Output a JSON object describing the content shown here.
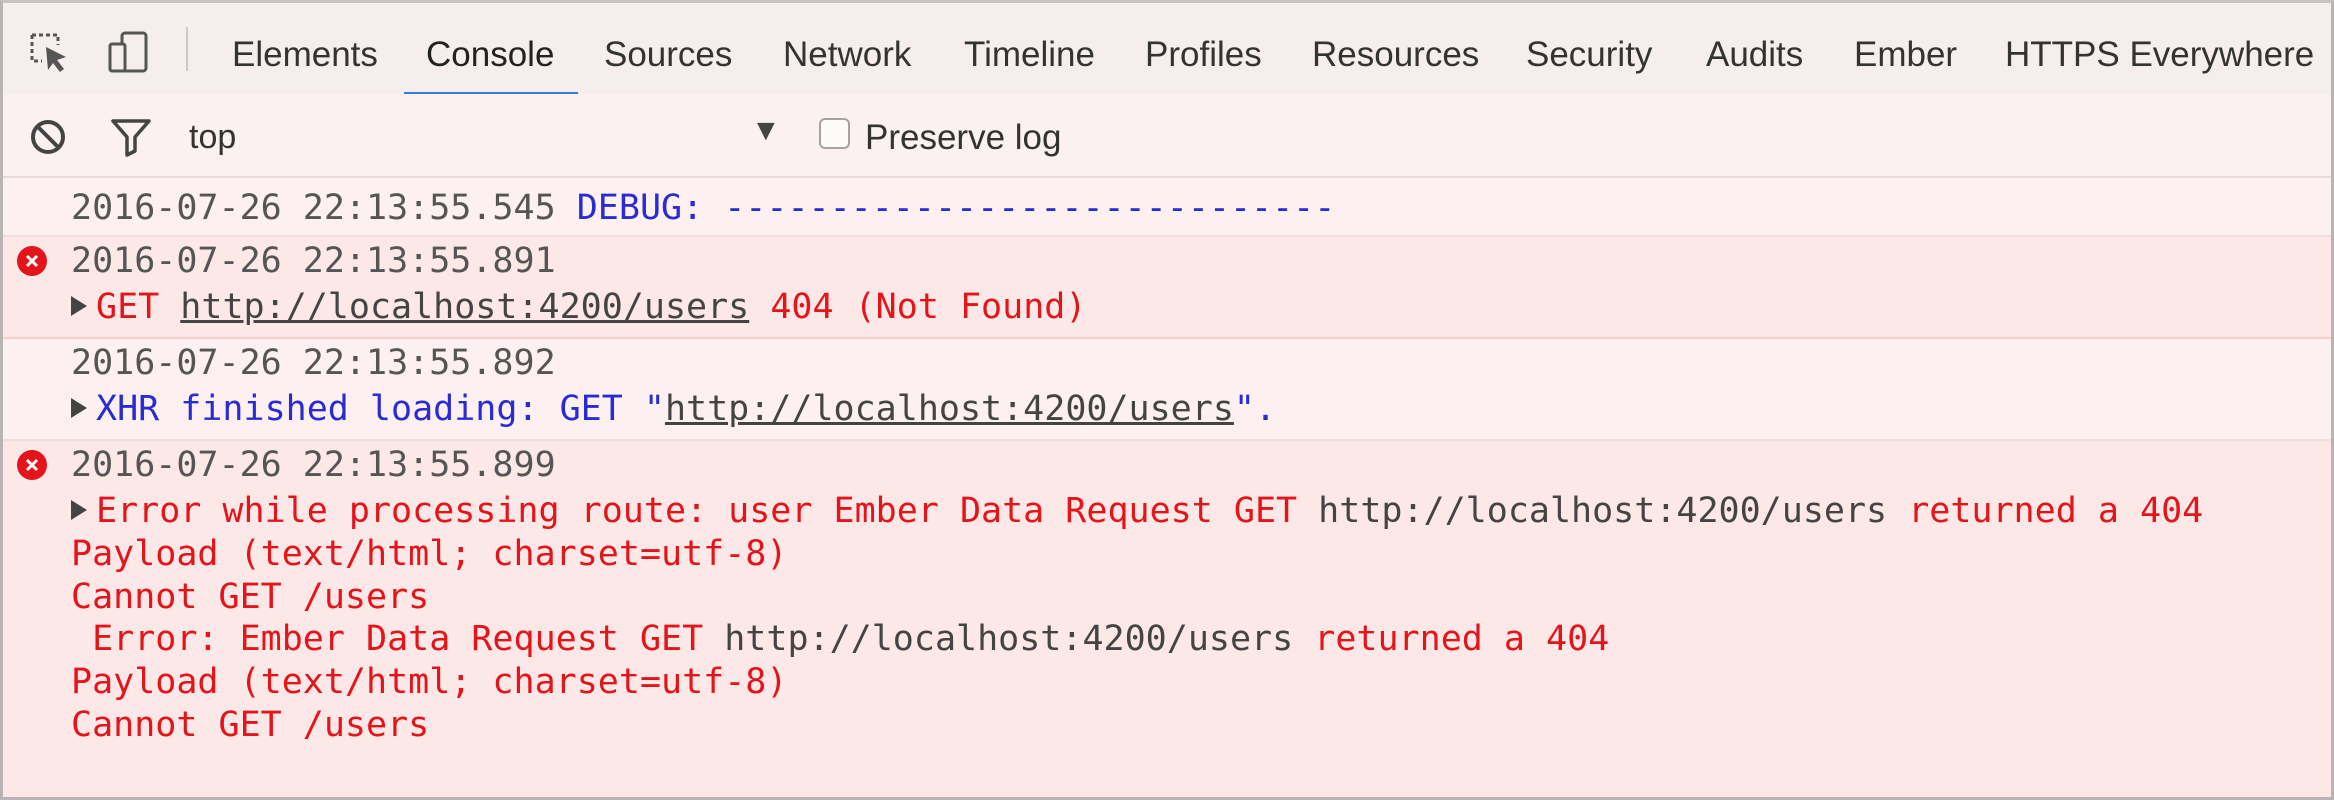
{
  "tabs": [
    {
      "label": "Elements"
    },
    {
      "label": "Console"
    },
    {
      "label": "Sources"
    },
    {
      "label": "Network"
    },
    {
      "label": "Timeline"
    },
    {
      "label": "Profiles"
    },
    {
      "label": "Resources"
    },
    {
      "label": "Security"
    },
    {
      "label": "Audits"
    },
    {
      "label": "Ember"
    },
    {
      "label": "HTTPS Everywhere"
    }
  ],
  "active_tab": "Console",
  "filter_bar": {
    "context": "top",
    "preserve_log_label": "Preserve log",
    "preserve_log_checked": false
  },
  "messages": {
    "m1": {
      "timestamp": "2016-07-26 22:13:55.545",
      "text": "DEBUG: -----------------------------"
    },
    "m2": {
      "level": "error",
      "timestamp": "2016-07-26 22:13:55.891",
      "method": "GET",
      "url": "http://localhost:4200/users",
      "status": "404 (Not Found)"
    },
    "m3": {
      "timestamp": "2016-07-26 22:13:55.892",
      "prefix": "XHR finished loading: GET \"",
      "url": "http://localhost:4200/users",
      "suffix": "\"."
    },
    "m4": {
      "level": "error",
      "timestamp": "2016-07-26 22:13:55.899",
      "line1_a": "Error while processing route: user Ember Data Request GET",
      "line1_url": "http://localhost:4200/users",
      "line1_b": "returned a 404",
      "line2": "Payload (text/html; charset=utf-8)",
      "line3": "Cannot GET /users",
      "line4_a": " Error: Ember Data Request GET",
      "line4_url": "http://localhost:4200/users",
      "line4_b": "returned a 404",
      "line5": "Payload (text/html; charset=utf-8)",
      "line6": "Cannot GET /users"
    }
  },
  "colors": {
    "accent": "#3879d9",
    "error_red": "#e4141b",
    "debug_blue": "#2b2bd6",
    "error_row_bg": "#fde8e8"
  },
  "icons": {
    "inspect": "inspect-element-icon",
    "device": "device-mode-icon",
    "clear": "clear-console-icon",
    "filter": "filter-icon",
    "dropdown": "dropdown-triangle-icon",
    "error": "error-circle-icon",
    "expand": "expand-triangle-icon"
  }
}
